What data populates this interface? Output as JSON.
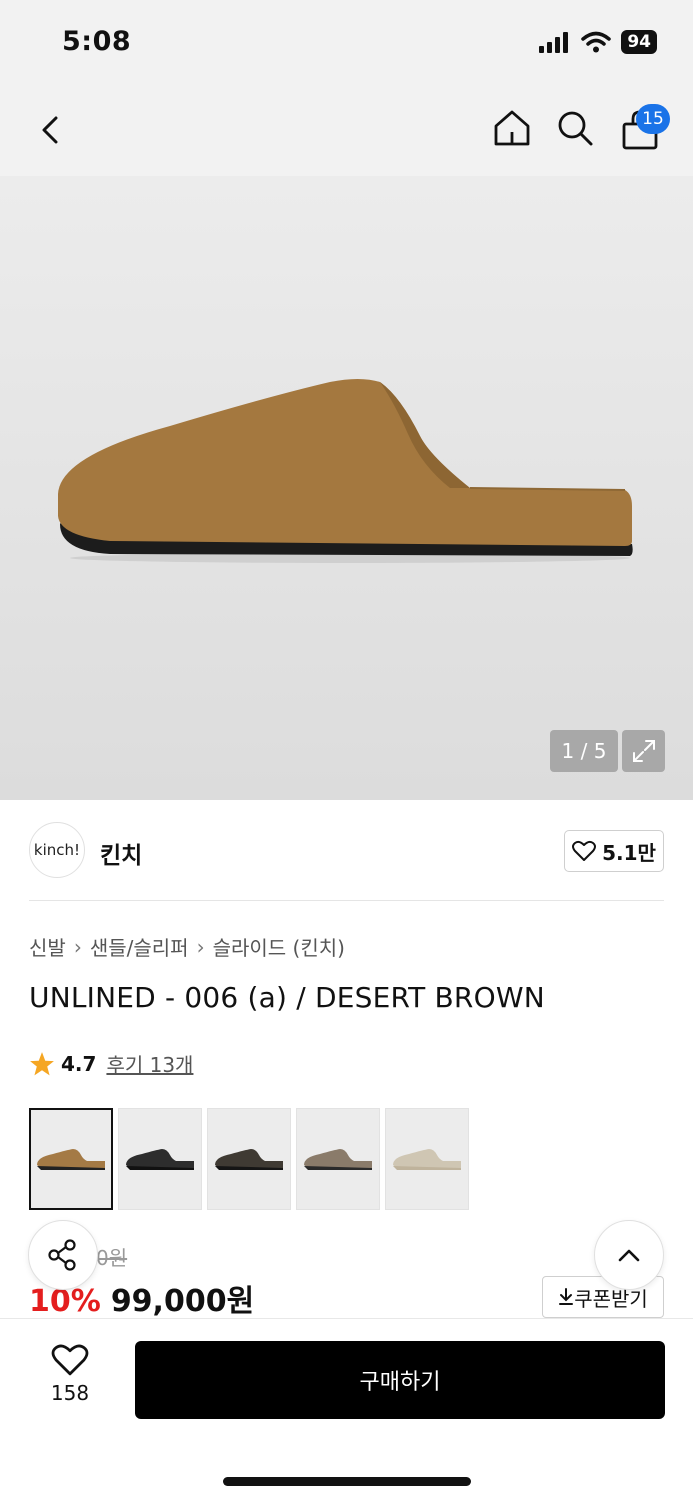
{
  "status_bar": {
    "time": "5:08",
    "battery": "94"
  },
  "nav": {
    "cart_count": "15"
  },
  "gallery": {
    "counter": "1 / 5"
  },
  "brand": {
    "logo_text": "kinch!",
    "name": "킨치",
    "likes": "5.1만"
  },
  "breadcrumb": [
    "신발",
    "샌들/슬리퍼",
    "슬라이드 (킨치)"
  ],
  "product": {
    "title": "UNLINED - 006 (a) / DESERT BROWN",
    "rating": "4.7",
    "review_text": "후기 13개",
    "original_price_visible": "0원",
    "discount": "10%",
    "price": "99,000원"
  },
  "colors": {
    "accent_blue": "#1a73e8",
    "discount_red": "#e41e1e",
    "star": "#f5a623",
    "thumbnails": [
      "#a47a45",
      "#2d2d2d",
      "#3f3a33",
      "#8a7b6a",
      "#cfc6b3"
    ]
  },
  "actions": {
    "coupon_label": "쿠폰받기",
    "wish_count": "158",
    "buy_label": "구매하기"
  }
}
